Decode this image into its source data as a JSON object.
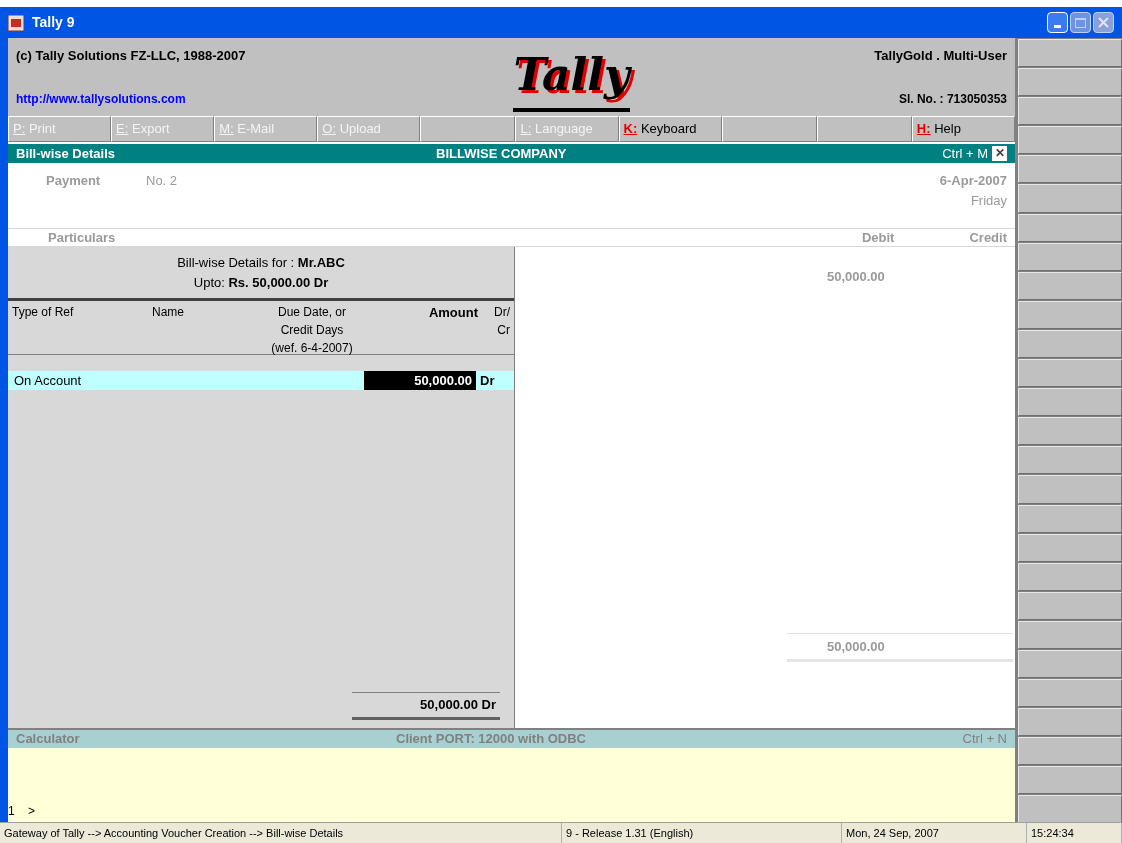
{
  "window": {
    "title": "Tally 9"
  },
  "header": {
    "copyright": "(c) Tally Solutions FZ-LLC, 1988-2007",
    "url": "http://www.tallysolutions.com",
    "logo": "Tally",
    "edition": "TallyGold . Multi-User",
    "serial": "Sl. No. : 713050353"
  },
  "toolbar": [
    {
      "kind": "key",
      "key": "P:",
      "label": "Print",
      "disabled": true
    },
    {
      "kind": "key",
      "key": "E:",
      "label": "Export",
      "disabled": true
    },
    {
      "kind": "key",
      "key": "M:",
      "label": "E-Mail",
      "disabled": true
    },
    {
      "kind": "key",
      "key": "O:",
      "label": "Upload",
      "disabled": true
    },
    {
      "kind": "blank"
    },
    {
      "kind": "key",
      "key": "L:",
      "label": "Language",
      "disabled": true
    },
    {
      "kind": "key",
      "key": "K:",
      "label": "Keyboard",
      "disabled": false
    },
    {
      "kind": "blank"
    },
    {
      "kind": "blank"
    },
    {
      "kind": "key",
      "key": "H:",
      "label": "Help",
      "disabled": false
    }
  ],
  "screen_bar": {
    "title": "Bill-wise Details",
    "company": "BILLWISE COMPANY",
    "shortcut": "Ctrl + M",
    "close": "✕"
  },
  "voucher": {
    "type": "Payment",
    "number": "No. 2",
    "date": "6-Apr-2007",
    "day": "Friday",
    "particulars": "Particulars",
    "debit": "Debit",
    "credit": "Credit",
    "debit_amount": "50,000.00",
    "debit_total": "50,000.00"
  },
  "billwise": {
    "heading": [
      "Bill-wise Details for : **Mr.ABC**",
      "Upto: **Rs. 50,000.00 Dr**"
    ],
    "columns": {
      "type": "Type of Ref",
      "name": "Name",
      "due": [
        "Due Date, or",
        "Credit Days",
        "(wef. 6-4-2007)"
      ],
      "amount": "Amount",
      "drcr": [
        "Dr/",
        "Cr"
      ]
    },
    "rows": [
      {
        "type": "On Account",
        "amount": "50,000.00",
        "drcr": "Dr",
        "selected": true
      }
    ],
    "total": "50,000.00 Dr"
  },
  "calculator": {
    "title": "Calculator",
    "port": "Client PORT: 12000 with ODBC",
    "shortcut": "Ctrl + N",
    "line": "1",
    "prompt": ">"
  },
  "status_bar": [
    "Gateway of Tally --> Accounting Voucher  Creation  --> Bill-wise Details",
    "9 - Release 1.31 (English)",
    "Mon, 24 Sep, 2007",
    "15:24:34"
  ]
}
